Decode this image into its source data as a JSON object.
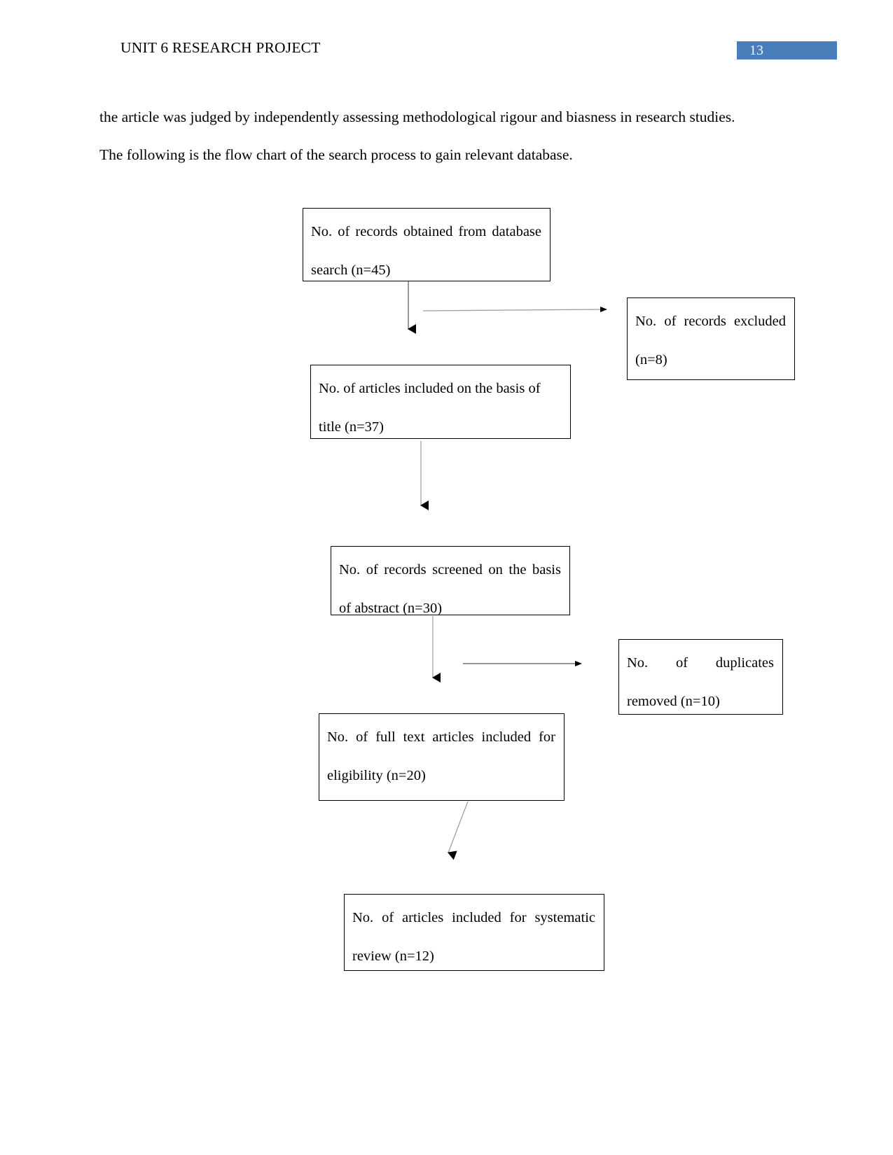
{
  "header": {
    "title": "UNIT 6 RESEARCH PROJECT",
    "page_number": "13",
    "badge_color": "#4a7ebb"
  },
  "body": {
    "paragraph": "the article was judged by independently assessing methodological rigour and biasness in research studies. The following is the flow chart of the search process to gain relevant database."
  },
  "flowchart": {
    "type": "prisma-flow-diagram",
    "boxes": [
      {
        "id": "records-obtained",
        "text": "No. of records obtained from database search (n=45)",
        "count": 45
      },
      {
        "id": "records-excluded",
        "text": "No. of records excluded (n=8)",
        "count": 8
      },
      {
        "id": "articles-included-title",
        "text": "No. of articles included on the basis of title (n=37)",
        "count": 37
      },
      {
        "id": "records-screened-abstract",
        "text": "No. of records screened on the basis of abstract (n=30)",
        "count": 30
      },
      {
        "id": "duplicates-removed",
        "text": "No. of duplicates removed (n=10)",
        "count": 10
      },
      {
        "id": "full-text-eligibility",
        "text": "No. of full text articles included for eligibility (n=20)",
        "count": 20
      },
      {
        "id": "articles-systematic-review",
        "text": "No. of articles included for systematic review (n=12)",
        "count": 12
      }
    ]
  }
}
